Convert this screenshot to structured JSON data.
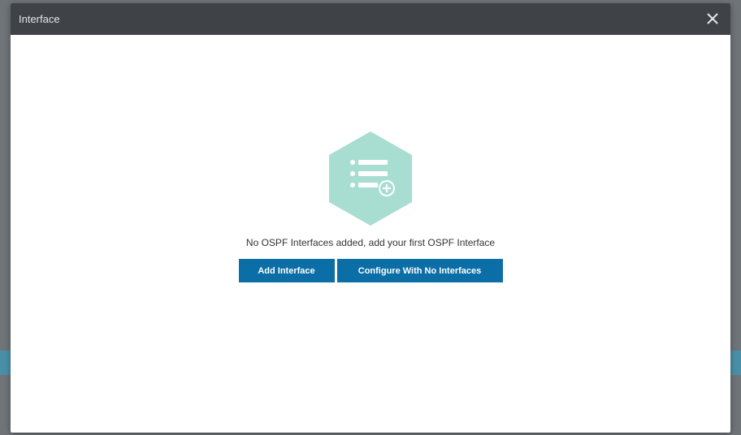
{
  "dialog": {
    "title": "Interface",
    "close_icon": "close-icon"
  },
  "empty_state": {
    "icon": "list-add-icon",
    "icon_color": "#a8ddd2",
    "message": "No OSPF Interfaces added, add your first OSPF Interface"
  },
  "actions": {
    "add_label": "Add Interface",
    "configure_label": "Configure With No Interfaces",
    "button_color": "#0b6ea6"
  }
}
